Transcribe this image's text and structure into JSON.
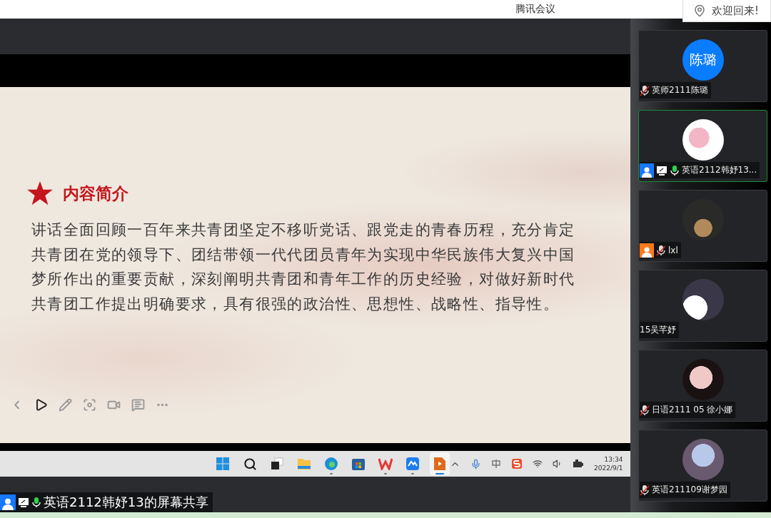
{
  "window": {
    "title": "腾讯会议"
  },
  "toast": {
    "text": "欢迎回来!"
  },
  "slide": {
    "title": "内容简介",
    "lines": [
      "讲话全面回顾一百年来共青团坚定不移听党话、跟党走的青春历程，充分肯定",
      "共青团在党的领导下、团结带领一代代团员青年为实现中华民族伟大复兴中国",
      "梦所作出的重要贡献，深刻阐明共青团和青年工作的历史经验，对做好新时代",
      "共青团工作提出明确要求，具有很强的政治性、思想性、战略性、指导性。"
    ],
    "tools": [
      {
        "kind": "previous",
        "selected": false
      },
      {
        "kind": "next",
        "selected": true
      },
      {
        "kind": "pen",
        "selected": false
      },
      {
        "kind": "focus",
        "selected": false
      },
      {
        "kind": "camera",
        "selected": false
      },
      {
        "kind": "subtitle",
        "selected": false
      },
      {
        "kind": "more",
        "selected": false
      }
    ]
  },
  "taskbar": {
    "apps": [
      {
        "kind": "start",
        "running": false,
        "active": false
      },
      {
        "kind": "search",
        "running": false,
        "active": false
      },
      {
        "kind": "taskview",
        "running": false,
        "active": false
      },
      {
        "kind": "folder",
        "running": false,
        "active": false
      },
      {
        "kind": "browser",
        "running": true,
        "active": false
      },
      {
        "kind": "store",
        "running": false,
        "active": false
      },
      {
        "kind": "office",
        "running": true,
        "active": false
      },
      {
        "kind": "meeting",
        "running": true,
        "active": false
      },
      {
        "kind": "slides",
        "running": true,
        "active": true
      }
    ],
    "time": "13:34",
    "date": "2022/9/1"
  },
  "share_label": {
    "color": "#1677ff",
    "sharing": true,
    "mic_on": true,
    "text": "英语2112韩妤13的屏幕共享"
  },
  "participants": [
    {
      "name": "英师2111陈璐",
      "initials": "陈璐",
      "selected": false,
      "mic_on": false,
      "mic_muted": true,
      "sharing": false
    },
    {
      "name": "英语2112韩妤13...",
      "selected": true,
      "mic_on": true,
      "mic_muted": false,
      "sharing": true,
      "color": "#1677ff"
    },
    {
      "name": "lxl",
      "selected": false,
      "mic_on": false,
      "mic_muted": true,
      "sharing": false,
      "color": "#ff7a1a"
    },
    {
      "name": "15吴芊妤",
      "selected": false,
      "mic_on": false,
      "mic_muted": false,
      "sharing": false
    },
    {
      "name": "日语2111 05 徐小娜",
      "selected": false,
      "mic_on": false,
      "mic_muted": true,
      "sharing": false
    },
    {
      "name": "英语211109谢梦园",
      "selected": false,
      "mic_on": false,
      "mic_muted": true,
      "sharing": false
    }
  ]
}
